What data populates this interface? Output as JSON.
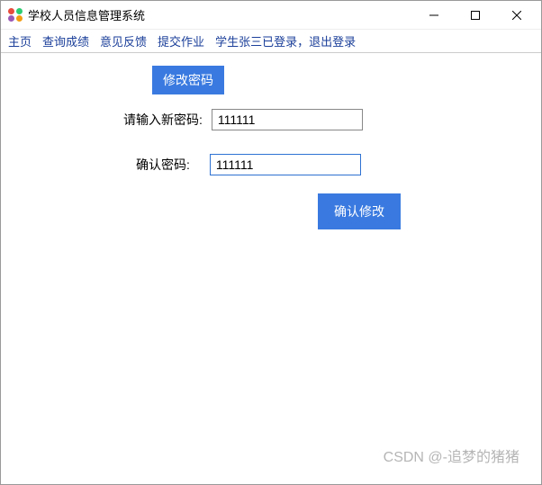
{
  "window": {
    "title": "学校人员信息管理系统"
  },
  "menu": {
    "home": "主页",
    "query": "查询成绩",
    "feedback": "意见反馈",
    "submit": "提交作业",
    "status": "学生张三已登录，退出登录"
  },
  "form": {
    "section_title": "修改密码",
    "new_password_label": "请输入新密码:",
    "new_password_value": "111111",
    "confirm_password_label": "确认密码:",
    "confirm_password_value": "111111",
    "submit_label": "确认修改"
  },
  "watermark": "CSDN @-追梦的猪猪"
}
